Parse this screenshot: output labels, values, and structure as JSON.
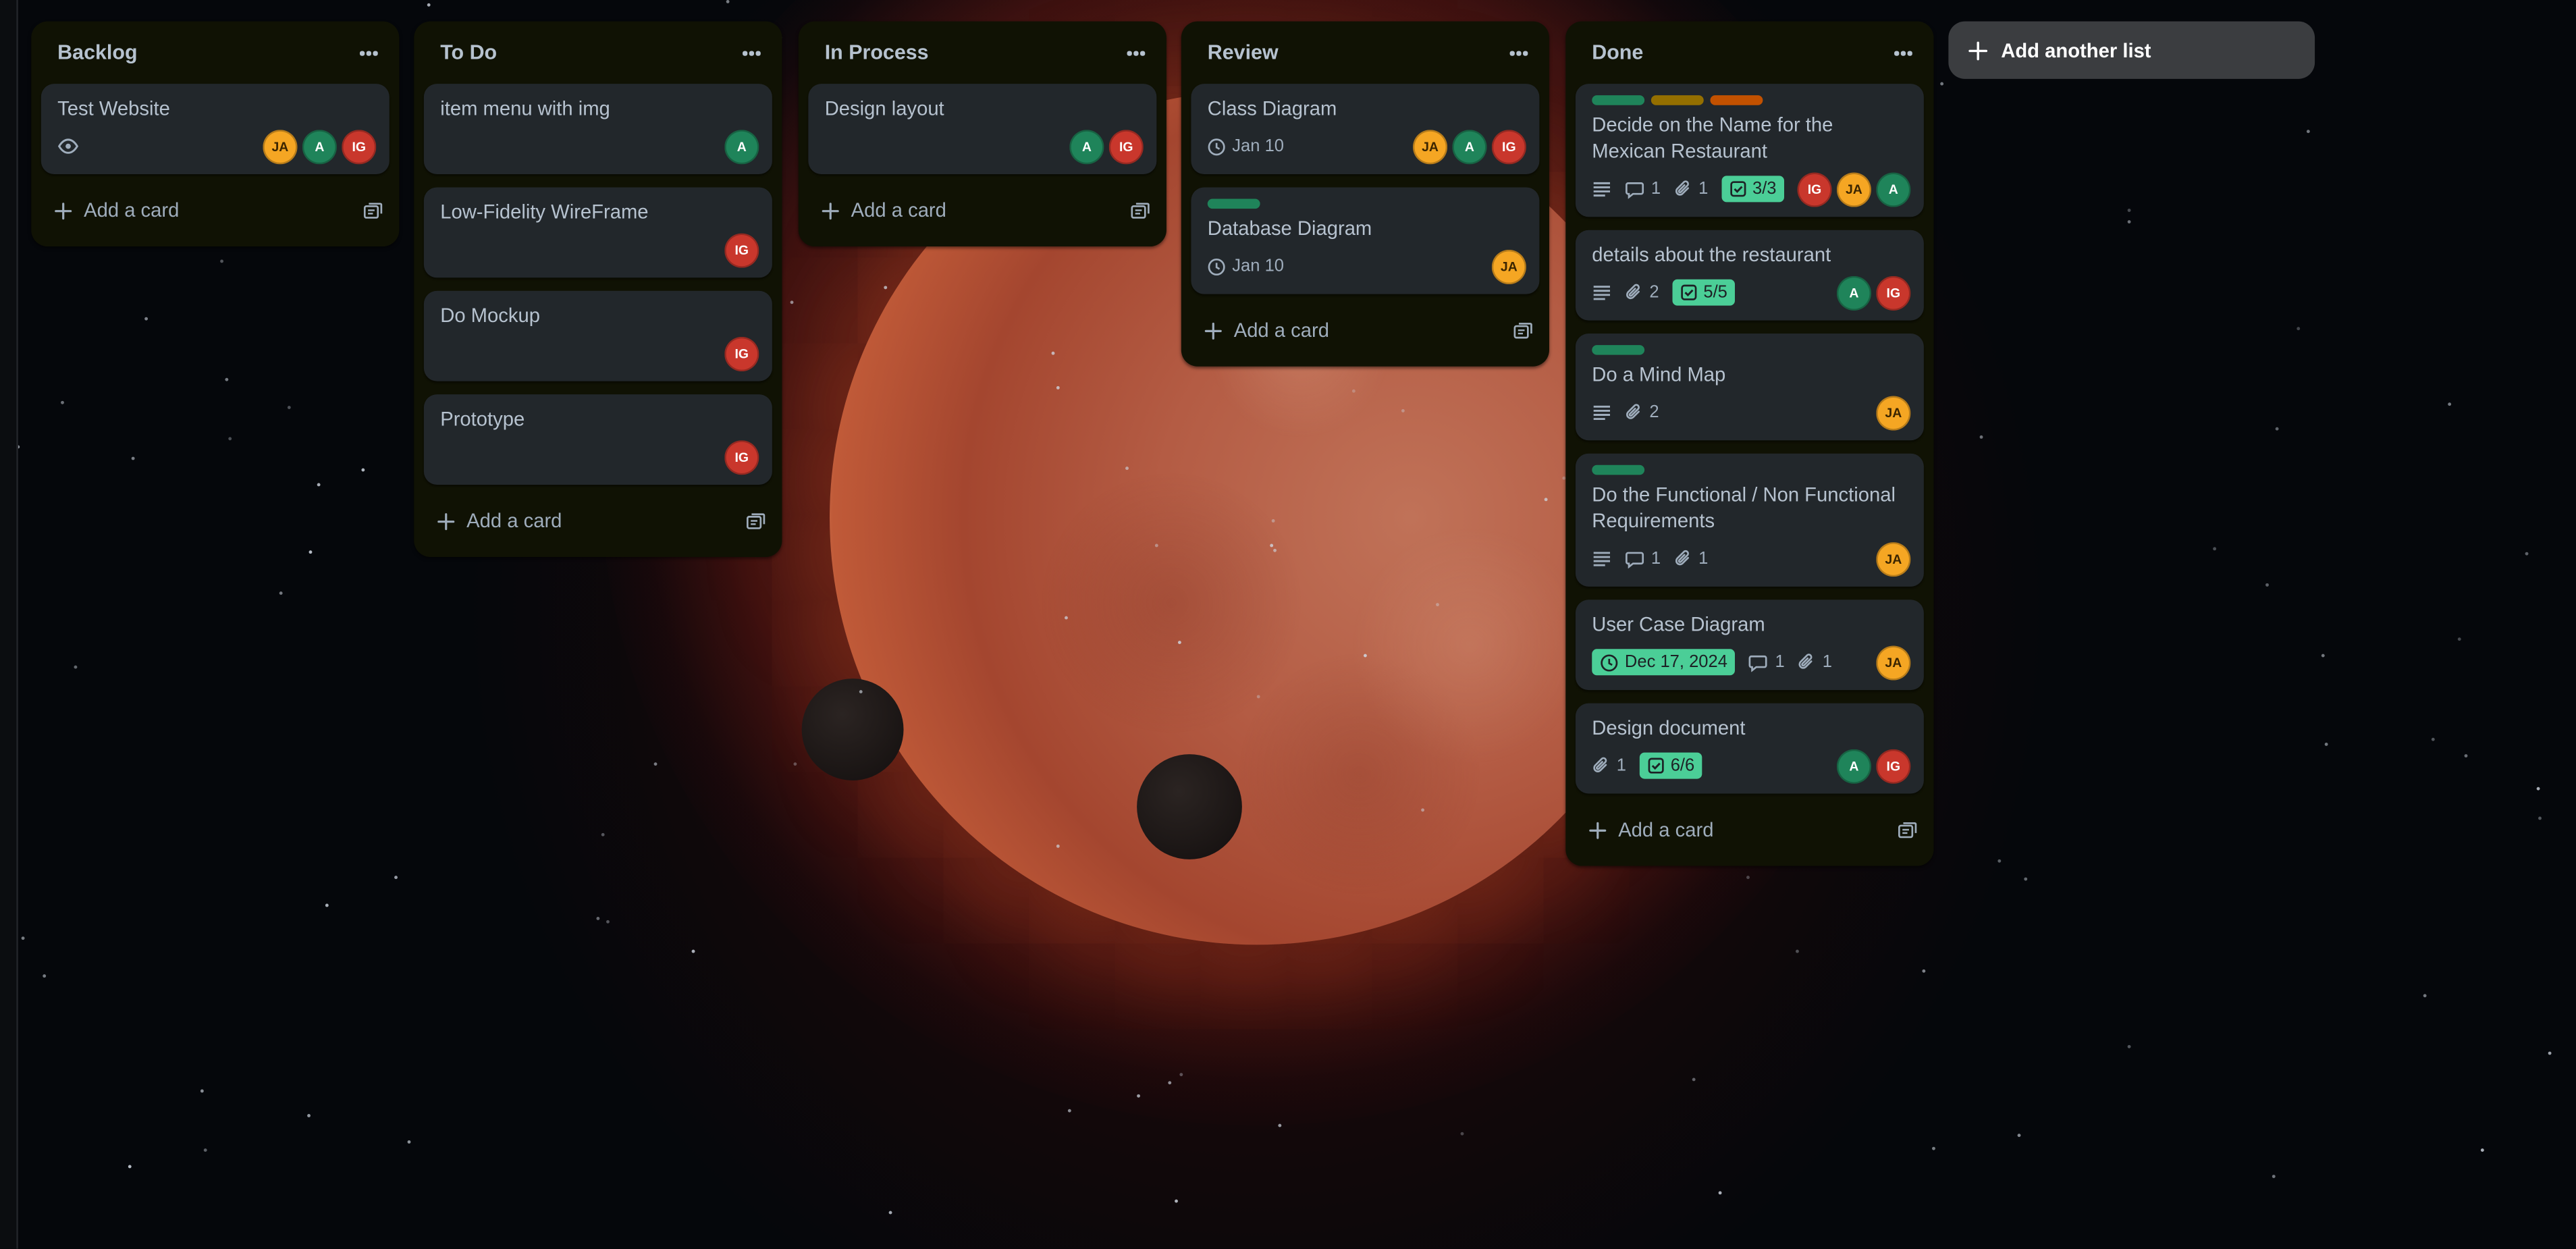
{
  "colors": {
    "list_bg": "#101204",
    "card_bg": "#22272b",
    "text": "#b6c2cf",
    "muted": "#9fadbc",
    "label_green": "#1f845a",
    "label_yellow": "#946f00",
    "label_orange": "#c25100",
    "badge_green": "#4bce97",
    "avatar_JA": "#f5a623",
    "avatar_A": "#1f845a",
    "avatar_IG": "#c9372c"
  },
  "add_card_label": "Add a card",
  "add_list_label": "Add another list",
  "lists": [
    {
      "title": "Backlog",
      "cards": [
        {
          "title": "Test Website",
          "watch": true,
          "avatars": [
            "JA",
            "A",
            "IG"
          ]
        }
      ]
    },
    {
      "title": "To Do",
      "cards": [
        {
          "title": "item menu with img",
          "avatars": [
            "A"
          ]
        },
        {
          "title": "Low-Fidelity WireFrame",
          "avatars": [
            "IG"
          ]
        },
        {
          "title": "Do Mockup",
          "avatars": [
            "IG"
          ]
        },
        {
          "title": "Prototype",
          "avatars": [
            "IG"
          ]
        }
      ]
    },
    {
      "title": "In Process",
      "cards": [
        {
          "title": "Design layout",
          "avatars": [
            "A",
            "IG"
          ]
        }
      ]
    },
    {
      "title": "Review",
      "cards": [
        {
          "title": "Class Diagram",
          "due": "Jan 10",
          "avatars": [
            "JA",
            "A",
            "IG"
          ]
        },
        {
          "title": "Database Diagram",
          "labels": [
            "green"
          ],
          "due": "Jan 10",
          "avatars": [
            "JA"
          ]
        }
      ]
    },
    {
      "title": "Done",
      "cards": [
        {
          "title": "Decide on the Name for the Mexican Restaurant",
          "labels": [
            "green",
            "yellow",
            "orange"
          ],
          "description": true,
          "comments": "1",
          "attachments": "1",
          "checklist": "3/3",
          "avatars": [
            "IG",
            "JA",
            "A"
          ]
        },
        {
          "title": "details about the restaurant",
          "description": true,
          "attachments": "2",
          "checklist": "5/5",
          "avatars": [
            "A",
            "IG"
          ]
        },
        {
          "title": "Do a Mind Map",
          "labels": [
            "green"
          ],
          "description": true,
          "attachments": "2",
          "avatars": [
            "JA"
          ]
        },
        {
          "title": "Do the Functional / Non Functional Requirements",
          "labels": [
            "green"
          ],
          "description": true,
          "comments": "1",
          "attachments": "1",
          "avatars": [
            "JA"
          ]
        },
        {
          "title": "User Case Diagram",
          "due_complete": "Dec 17, 2024",
          "comments": "1",
          "attachments": "1",
          "avatars": [
            "JA"
          ]
        },
        {
          "title": "Design document",
          "attachments": "1",
          "checklist": "6/6",
          "avatars": [
            "A",
            "IG"
          ]
        }
      ]
    }
  ]
}
